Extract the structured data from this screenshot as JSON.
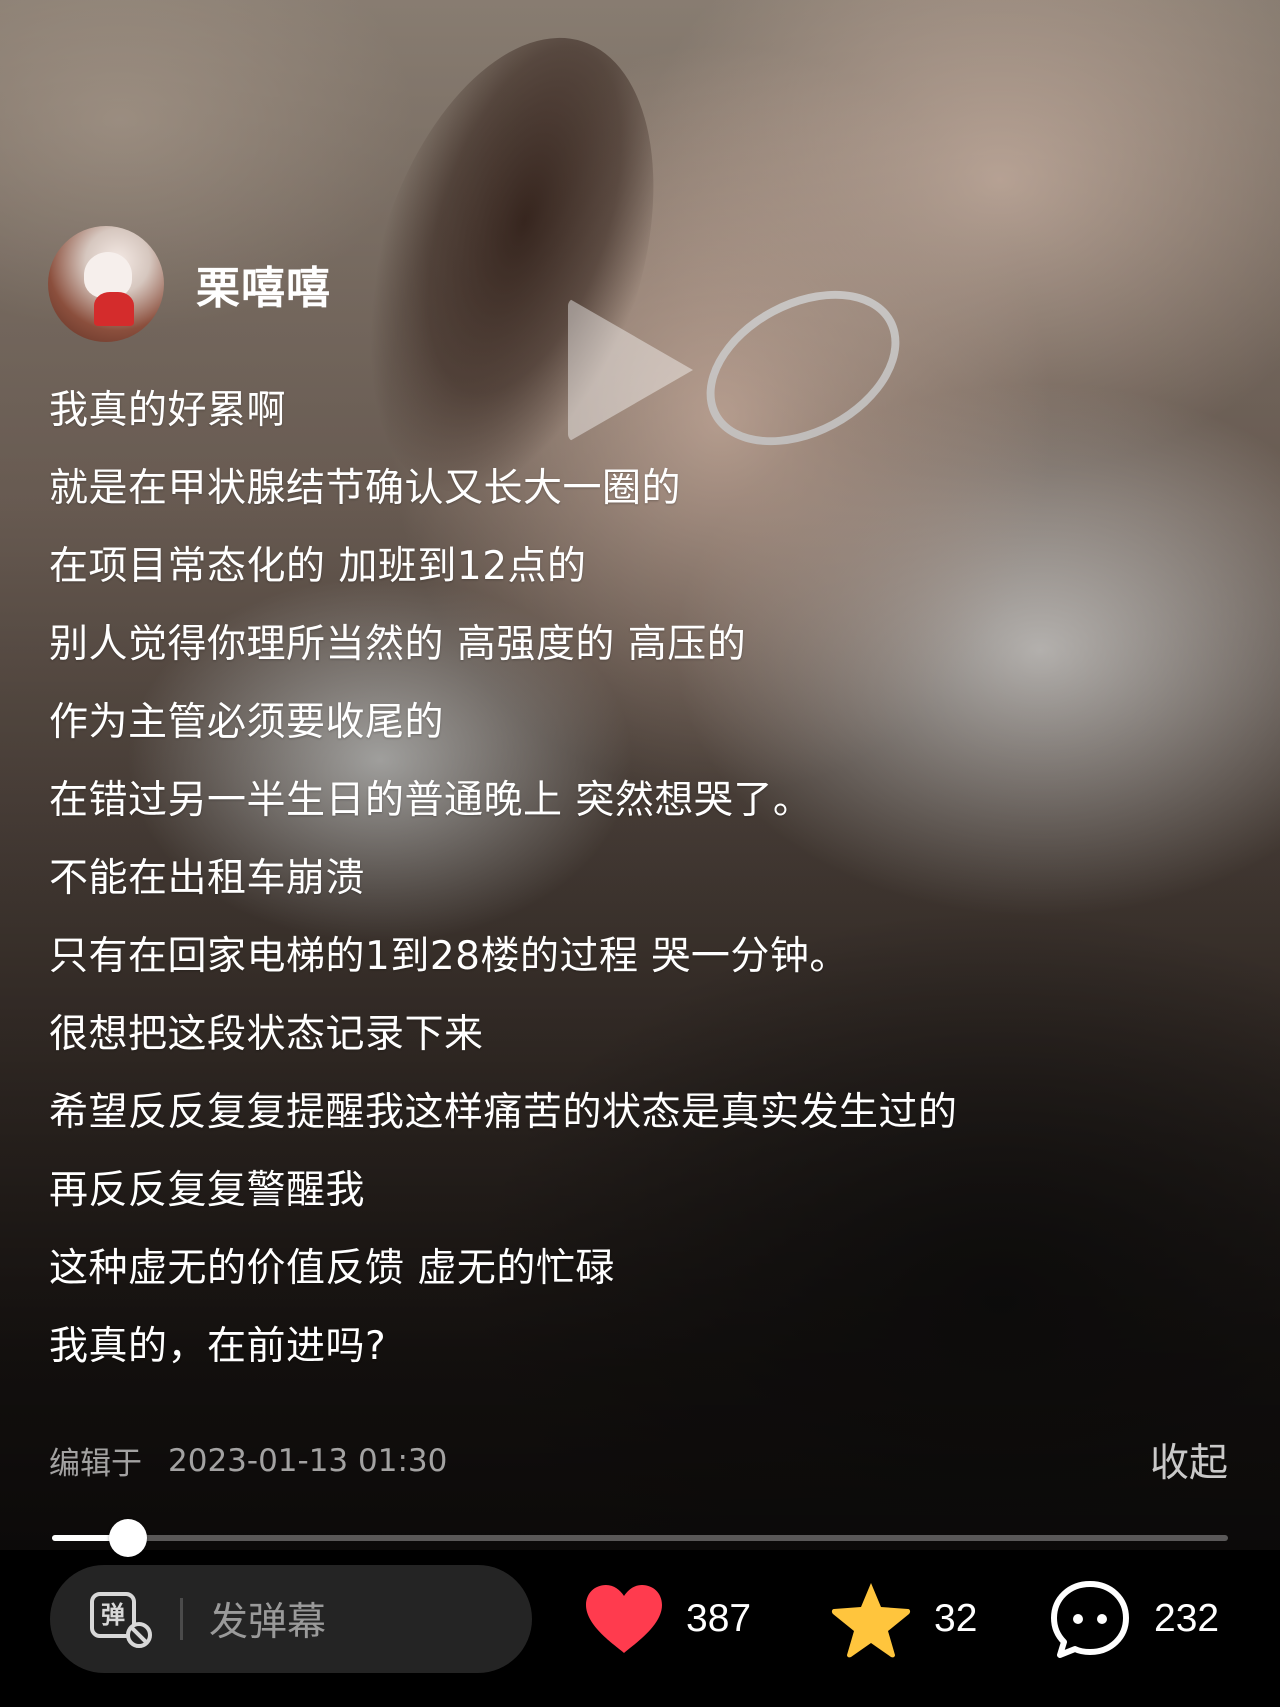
{
  "author": {
    "name": "栗嘻嘻"
  },
  "post": {
    "lines": [
      "我真的好累啊",
      "就是在甲状腺结节确认又长大一圈的",
      "在项目常态化的 加班到12点的",
      "别人觉得你理所当然的 高强度的 高压的",
      "作为主管必须要收尾的",
      "在错过另一半生日的普通晚上 突然想哭了。",
      "不能在出租车崩溃",
      "只有在回家电梯的1到28楼的过程 哭一分钟。",
      "很想把这段状态记录下来",
      "希望反反复复提醒我这样痛苦的状态是真实发生过的",
      "再反反复复警醒我",
      "这种虚无的价值反馈 虚无的忙碌",
      "我真的，在前进吗?"
    ],
    "edited_label": "编辑于",
    "edited_time": "2023-01-13 01:30",
    "collapse_label": "收起"
  },
  "player": {
    "progress": 0.065,
    "play_icon": "play-icon"
  },
  "bottom_bar": {
    "danmaku_icon_glyph": "弹",
    "danmaku_placeholder": "发弹幕",
    "likes": "387",
    "favorites": "32",
    "comments": "232"
  },
  "colors": {
    "like": "#ff3b4e",
    "star": "#ffc53d",
    "bar_bg": "#000000",
    "input_bg": "#242424"
  }
}
